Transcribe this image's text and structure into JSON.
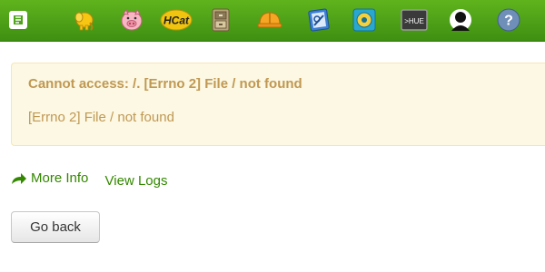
{
  "nav": {
    "icons": [
      "hue-logo-icon",
      "beeswax-elephant-icon",
      "pig-icon",
      "hcat-icon",
      "file-cabinet-icon",
      "hard-hat-icon",
      "job-designer-icon",
      "oozie-icon",
      "shell-icon",
      "user-admin-icon",
      "help-icon"
    ],
    "hcat_label": "HCat",
    "shell_label": ">HUE"
  },
  "alert": {
    "title": "Cannot access: /. [Errno 2] File / not found",
    "message": "[Errno 2] File / not found"
  },
  "links": {
    "more_info": "More Info",
    "view_logs": "View Logs"
  },
  "buttons": {
    "go_back": "Go back"
  },
  "colors": {
    "topbar": "#4fa31a",
    "alert_bg": "#fcf8e3",
    "alert_text": "#c09853",
    "link": "#338800"
  }
}
